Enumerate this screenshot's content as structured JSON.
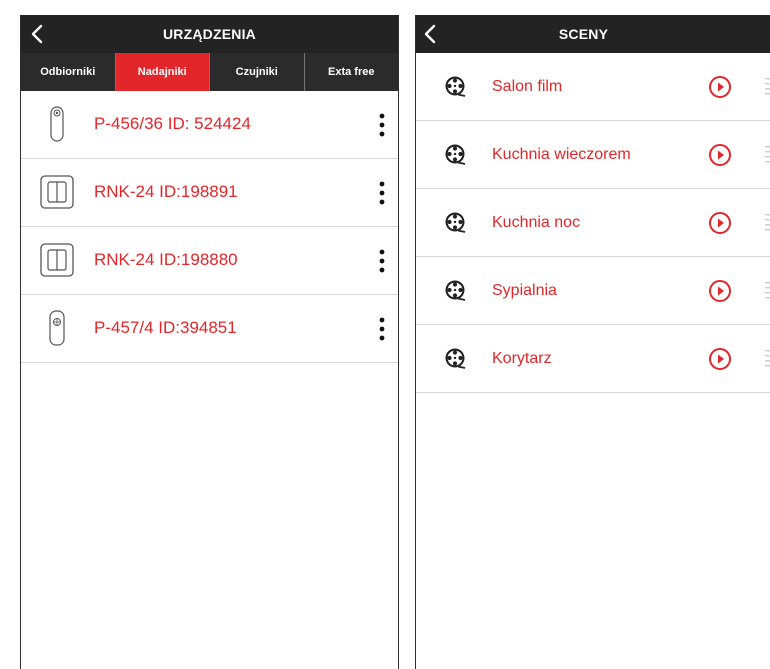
{
  "left": {
    "title": "URZĄDZENIA",
    "tabs": [
      {
        "label": "Odbiorniki",
        "active": false
      },
      {
        "label": "Nadajniki",
        "active": true
      },
      {
        "label": "Czujniki",
        "active": false
      },
      {
        "label": "Exta free",
        "active": false
      }
    ],
    "devices": [
      {
        "label": "P-456/36 ID: 524424",
        "icon": "remote-pendant-icon"
      },
      {
        "label": "RNK-24 ID:198891",
        "icon": "wall-switch-icon"
      },
      {
        "label": "RNK-24 ID:198880",
        "icon": "wall-switch-icon"
      },
      {
        "label": "P-457/4 ID:394851",
        "icon": "remote-keyfob-icon"
      }
    ]
  },
  "right": {
    "title": "SCENY",
    "scenes": [
      {
        "label": "Salon film"
      },
      {
        "label": "Kuchnia wieczorem"
      },
      {
        "label": "Kuchnia noc"
      },
      {
        "label": "Sypialnia"
      },
      {
        "label": "Korytarz"
      }
    ]
  },
  "colors": {
    "accent": "#e3262a",
    "header": "#232323",
    "tabbar": "#2b2b2b",
    "divider": "#d7d7d7"
  }
}
